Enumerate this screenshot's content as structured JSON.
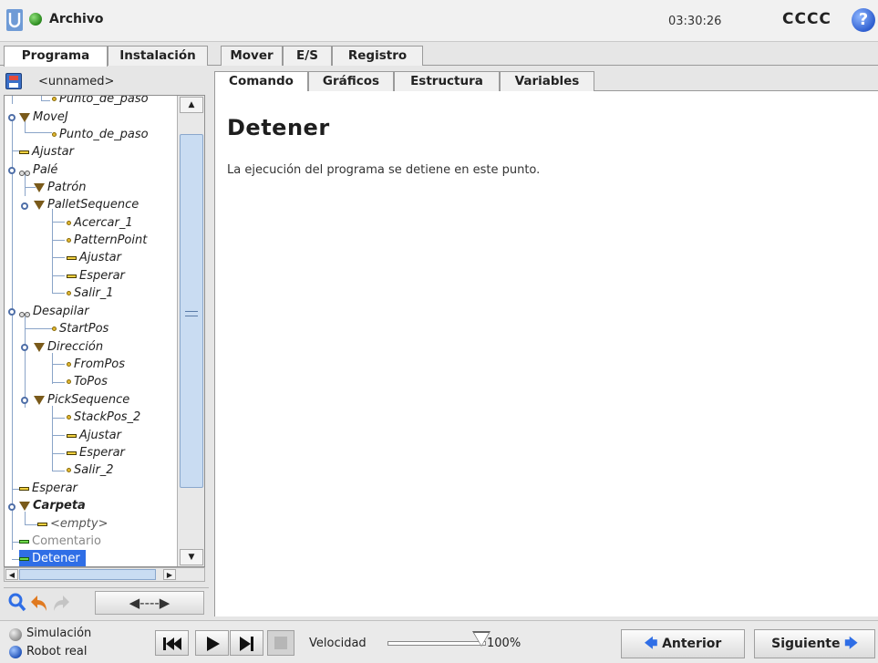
{
  "titlebar": {
    "title": "Archivo",
    "time": "03:30:26",
    "robot_name": "CCCC",
    "help_glyph": "?"
  },
  "main_tabs": [
    {
      "label": "Programa",
      "active": true
    },
    {
      "label": "Instalación",
      "active": false
    },
    {
      "label": "Mover",
      "active": false
    },
    {
      "label": "E/S",
      "active": false
    },
    {
      "label": "Registro",
      "active": false
    }
  ],
  "program": {
    "filename": "<unnamed>"
  },
  "tree": {
    "nodes": [
      {
        "label": "Punto_de_paso",
        "icon": "waypoint-icon"
      },
      {
        "label": "MoveJ",
        "icon": "move-icon"
      },
      {
        "label": "Punto_de_paso",
        "icon": "waypoint-icon"
      },
      {
        "label": "Ajustar",
        "icon": "command-icon"
      },
      {
        "label": "Palé",
        "icon": "pallet-icon"
      },
      {
        "label": "Patrón",
        "icon": "folder-icon"
      },
      {
        "label": "PalletSequence",
        "icon": "folder-icon"
      },
      {
        "label": "Acercar_1",
        "icon": "waypoint-icon"
      },
      {
        "label": "PatternPoint",
        "icon": "waypoint-icon"
      },
      {
        "label": "Ajustar",
        "icon": "command-icon"
      },
      {
        "label": "Esperar",
        "icon": "command-icon"
      },
      {
        "label": "Salir_1",
        "icon": "waypoint-icon"
      },
      {
        "label": "Desapilar",
        "icon": "pallet-icon"
      },
      {
        "label": "StartPos",
        "icon": "waypoint-icon"
      },
      {
        "label": "Dirección",
        "icon": "folder-icon"
      },
      {
        "label": "FromPos",
        "icon": "waypoint-icon"
      },
      {
        "label": "ToPos",
        "icon": "waypoint-icon"
      },
      {
        "label": "PickSequence",
        "icon": "folder-icon"
      },
      {
        "label": "StackPos_2",
        "icon": "waypoint-icon"
      },
      {
        "label": "Ajustar",
        "icon": "command-icon"
      },
      {
        "label": "Esperar",
        "icon": "command-icon"
      },
      {
        "label": "Salir_2",
        "icon": "waypoint-icon"
      },
      {
        "label": "Esperar",
        "icon": "command-icon"
      },
      {
        "label": "Carpeta",
        "icon": "folder-icon"
      },
      {
        "label": "<empty>",
        "icon": "command-icon"
      },
      {
        "label": "Comentario",
        "icon": "comment-icon"
      },
      {
        "label": "Detener",
        "icon": "halt-icon",
        "selected": true
      }
    ],
    "move_button_glyph": "◀----▶"
  },
  "content_tabs": [
    {
      "label": "Comando",
      "active": true
    },
    {
      "label": "Gráficos",
      "active": false
    },
    {
      "label": "Estructura",
      "active": false
    },
    {
      "label": "Variables",
      "active": false
    }
  ],
  "content": {
    "heading": "Detener",
    "description": "La ejecución del programa se detiene en este punto."
  },
  "bottom": {
    "simulation_label": "Simulación",
    "real_robot_label": "Robot real",
    "mode_selected": "Robot real",
    "speed_label": "Velocidad",
    "speed_value": "100%",
    "speed_fraction": 1.0,
    "prev_label": "Anterior",
    "next_label": "Siguiente"
  },
  "colors": {
    "accent": "#2f6ee6",
    "selection": "#2f6ee6",
    "status_green": "#2b8a1e"
  }
}
